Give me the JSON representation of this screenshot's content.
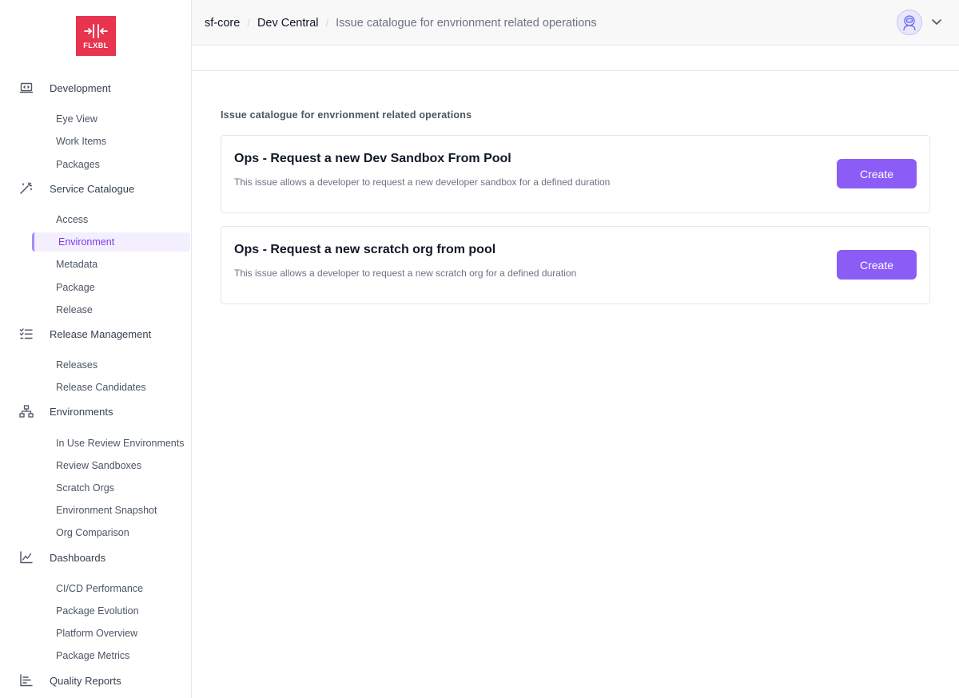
{
  "logo": {
    "text": "FLXBL",
    "color": "#e8344e"
  },
  "sidebar": {
    "sections": [
      {
        "label": "Development",
        "icon": "laptop-code-icon",
        "items": [
          "Eye View",
          "Work Items",
          "Packages"
        ]
      },
      {
        "label": "Service Catalogue",
        "icon": "magic-wand-icon",
        "items": [
          "Access",
          "Environment",
          "Metadata",
          "Package",
          "Release"
        ]
      },
      {
        "label": "Release Management",
        "icon": "checklist-icon",
        "items": [
          "Releases",
          "Release Candidates"
        ]
      },
      {
        "label": "Environments",
        "icon": "network-icon",
        "items": [
          "In Use Review Environments",
          "Review Sandboxes",
          "Scratch Orgs",
          "Environment Snapshot",
          "Org Comparison"
        ]
      },
      {
        "label": "Dashboards",
        "icon": "line-chart-icon",
        "items": [
          "CI/CD Performance",
          "Package Evolution",
          "Platform Overview",
          "Package Metrics"
        ]
      },
      {
        "label": "Quality Reports",
        "icon": "bar-chart-icon",
        "items": []
      }
    ],
    "active_item": "Environment"
  },
  "breadcrumb": [
    "sf-core",
    "Dev Central",
    "Issue catalogue for envrionment related operations"
  ],
  "main": {
    "section_title": "Issue catalogue for envrionment related operations",
    "cards": [
      {
        "title": "Ops - Request a new Dev Sandbox From Pool",
        "description": "This issue allows a developer to request a new developer sandbox for a defined duration",
        "button": "Create"
      },
      {
        "title": "Ops - Request a new scratch org from pool",
        "description": "This issue allows a developer to request a new scratch org for a defined duration",
        "button": "Create"
      }
    ]
  },
  "colors": {
    "accent": "#8b5cf6",
    "active_text": "#7c3aed",
    "active_bg": "#f3effe"
  }
}
